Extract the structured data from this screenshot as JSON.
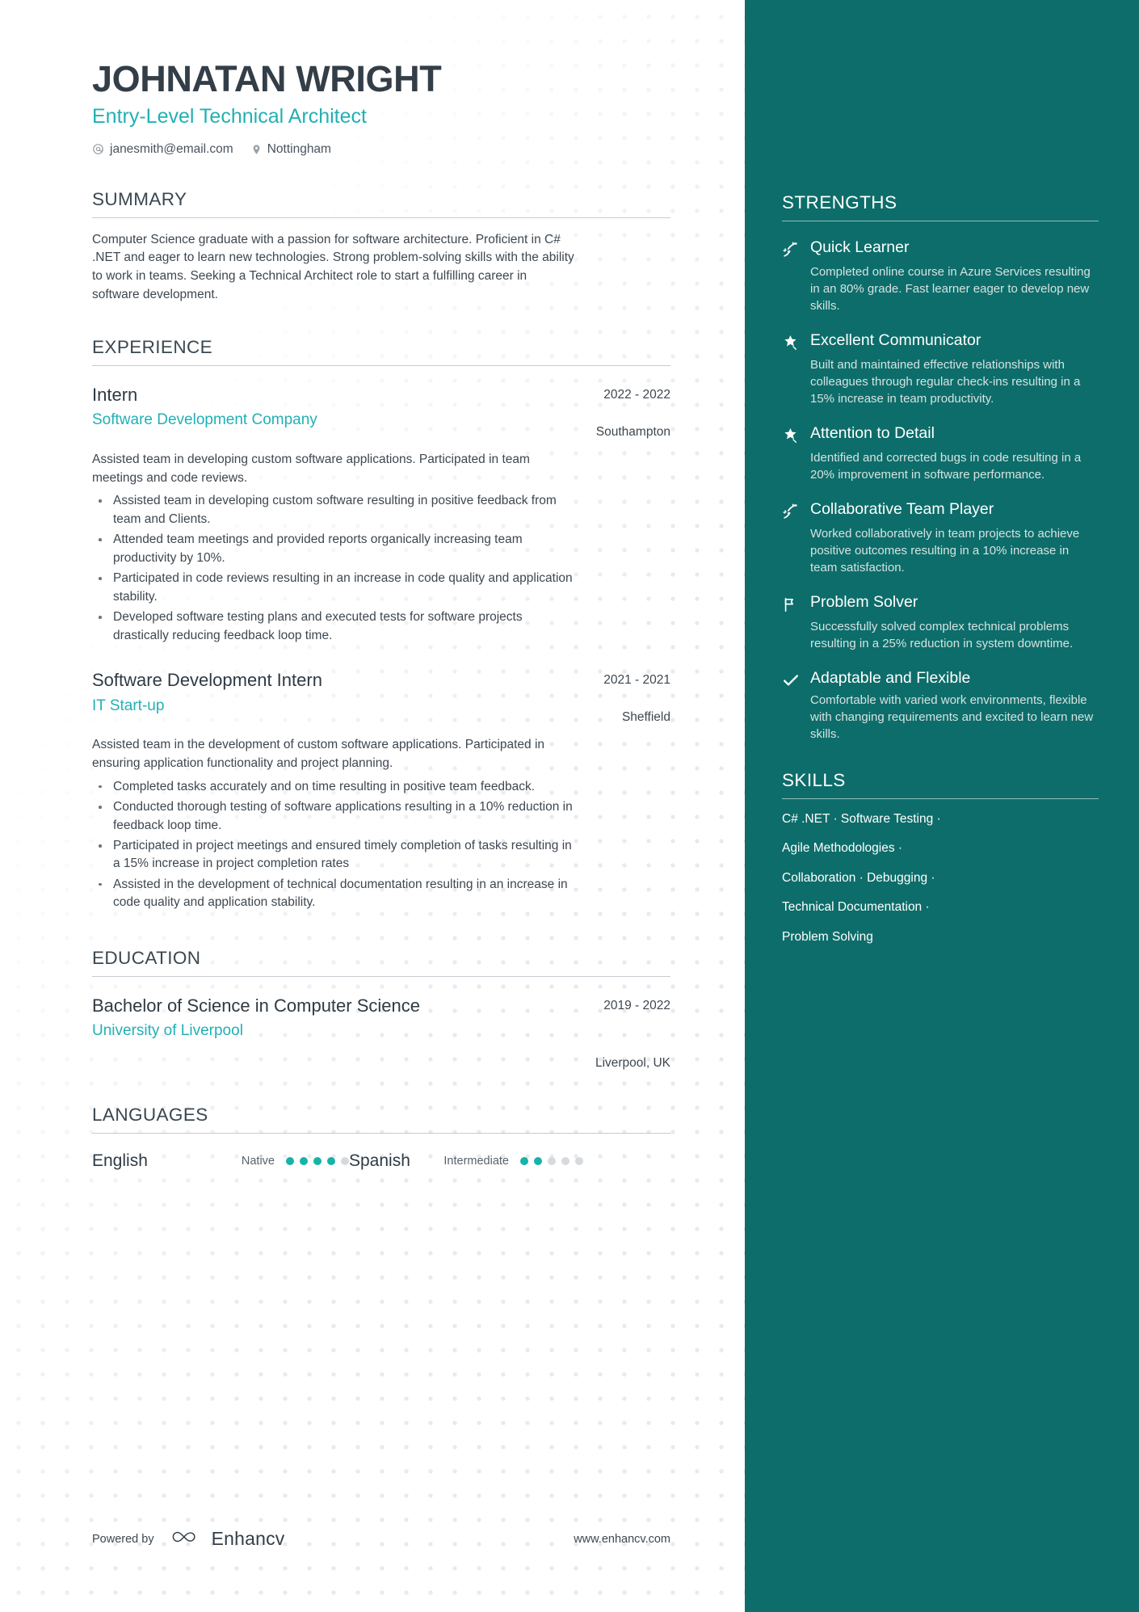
{
  "header": {
    "name": "JOHNATAN WRIGHT",
    "job_title": "Entry-Level Technical Architect",
    "email": "janesmith@email.com",
    "location": "Nottingham",
    "email_icon": "at-sign-icon",
    "location_icon": "map-pin-icon"
  },
  "summary": {
    "heading": "SUMMARY",
    "text": "Computer Science graduate with a passion for software architecture. Proficient in C# .NET and eager to learn new technologies. Strong problem-solving skills with the ability to work in teams. Seeking a Technical Architect role to start a fulfilling career in software development."
  },
  "experience": {
    "heading": "EXPERIENCE",
    "entries": [
      {
        "title": "Intern",
        "organization": "Software Development Company",
        "date": "2022 - 2022",
        "location": "Southampton",
        "description": "Assisted team in developing custom software applications. Participated in team meetings and code reviews.",
        "bullets": [
          "Assisted team in developing custom software resulting in positive feedback from team and Clients.",
          "Attended team meetings and provided reports organically increasing team productivity by 10%.",
          "Participated in code reviews resulting in an increase in code quality and application stability.",
          "Developed software testing plans and executed tests for software projects drastically reducing feedback loop time."
        ]
      },
      {
        "title": "Software Development Intern",
        "organization": "IT Start-up",
        "date": "2021 - 2021",
        "location": "Sheffield",
        "description": "Assisted team in the development of custom software applications. Participated in ensuring application functionality and project planning.",
        "bullets": [
          "Completed tasks accurately and on time resulting in positive team feedback.",
          "Conducted thorough testing of software applications resulting in a 10% reduction in feedback loop time.",
          "Participated in project meetings and ensured timely completion of tasks resulting in a 15% increase in project completion rates",
          "Assisted in the development of technical documentation resulting in an increase in code quality and application stability."
        ]
      }
    ]
  },
  "education": {
    "heading": "EDUCATION",
    "entries": [
      {
        "title": "Bachelor of Science in Computer Science",
        "organization": "University of Liverpool",
        "date": "2019 - 2022",
        "location": "Liverpool, UK"
      }
    ]
  },
  "languages": {
    "heading": "LANGUAGES",
    "items": [
      {
        "name": "English",
        "level": "Native",
        "filled": 4,
        "total": 5
      },
      {
        "name": "Spanish",
        "level": "Intermediate",
        "filled": 2,
        "total": 5
      }
    ]
  },
  "strengths": {
    "heading": "STRENGTHS",
    "items": [
      {
        "name": "Quick Learner",
        "icon": "rocket-trajectory-icon",
        "description": "Completed online course in Azure Services resulting in an 80% grade. Fast learner eager to develop new skills."
      },
      {
        "name": "Excellent Communicator",
        "icon": "star-shooting-icon",
        "description": "Built and maintained effective relationships with colleagues through regular check-ins resulting in a 15% increase in team productivity."
      },
      {
        "name": "Attention to Detail",
        "icon": "star-shooting-icon",
        "description": "Identified and corrected bugs in code resulting in a 20% improvement in software performance."
      },
      {
        "name": "Collaborative Team Player",
        "icon": "rocket-trajectory-icon",
        "description": "Worked collaboratively in team projects to achieve positive outcomes resulting in a 10% increase in team satisfaction."
      },
      {
        "name": "Problem Solver",
        "icon": "flag-icon",
        "description": "Successfully solved complex technical problems resulting in a 25% reduction in system downtime."
      },
      {
        "name": "Adaptable and Flexible",
        "icon": "check-icon",
        "description": "Comfortable with varied work environments, flexible with changing requirements and excited to learn new skills."
      }
    ]
  },
  "skills": {
    "heading": "SKILLS",
    "lines": [
      "C# .NET · Software Testing ·",
      "Agile Methodologies ·",
      "Collaboration · Debugging ·",
      "Technical Documentation ·",
      "Problem Solving"
    ]
  },
  "footer": {
    "powered_by": "Powered by",
    "brand": "Enhancv",
    "brand_icon": "enhancv-logo-icon",
    "website": "www.enhancv.com"
  },
  "colors": {
    "accent_teal": "#22b0b5",
    "sidebar_bg": "#0d6d6a",
    "heading_dark": "#333e48",
    "rating_on": "#16b3a8"
  }
}
